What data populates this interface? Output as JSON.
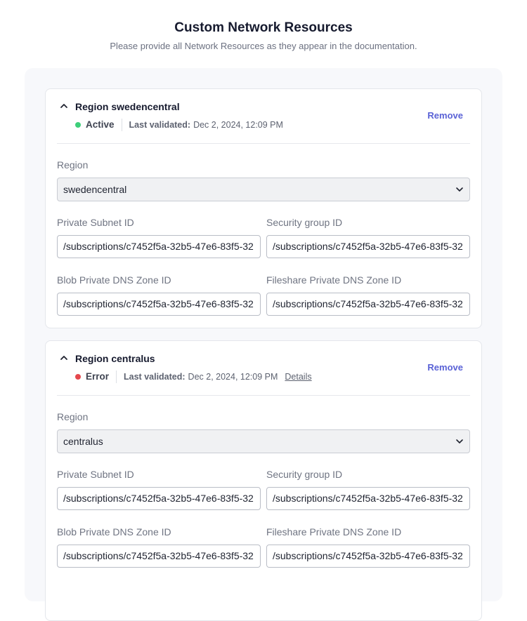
{
  "header": {
    "title": "Custom Network Resources",
    "subtitle": "Please provide all Network Resources as they appear in the documentation."
  },
  "colors": {
    "active": "#3ecf7a",
    "error": "#e5484d",
    "accent": "#5a62d6"
  },
  "regions": [
    {
      "title": "Region swedencentral",
      "status": "Active",
      "last_validated_label": "Last validated:",
      "last_validated_value": "Dec 2, 2024, 12:09 PM",
      "remove_label": "Remove",
      "region_label": "Region",
      "region_value": "swedencentral",
      "private_subnet_label": "Private Subnet ID",
      "private_subnet_value": "/subscriptions/c7452f5a-32b5-47e6-83f5-32",
      "security_group_label": "Security group ID",
      "security_group_value": "/subscriptions/c7452f5a-32b5-47e6-83f5-32",
      "blob_dns_label": "Blob Private DNS Zone ID",
      "blob_dns_value": "/subscriptions/c7452f5a-32b5-47e6-83f5-32",
      "fileshare_dns_label": "Fileshare Private DNS Zone ID",
      "fileshare_dns_value": "/subscriptions/c7452f5a-32b5-47e6-83f5-32"
    },
    {
      "title": "Region centralus",
      "status": "Error",
      "last_validated_label": "Last validated:",
      "last_validated_value": "Dec 2, 2024, 12:09 PM",
      "details_label": "Details",
      "remove_label": "Remove",
      "region_label": "Region",
      "region_value": "centralus",
      "private_subnet_label": "Private Subnet ID",
      "private_subnet_value": "/subscriptions/c7452f5a-32b5-47e6-83f5-32",
      "security_group_label": "Security group ID",
      "security_group_value": "/subscriptions/c7452f5a-32b5-47e6-83f5-32",
      "blob_dns_label": "Blob Private DNS Zone ID",
      "blob_dns_value": "/subscriptions/c7452f5a-32b5-47e6-83f5-32",
      "fileshare_dns_label": "Fileshare Private DNS Zone ID",
      "fileshare_dns_value": "/subscriptions/c7452f5a-32b5-47e6-83f5-32"
    }
  ]
}
